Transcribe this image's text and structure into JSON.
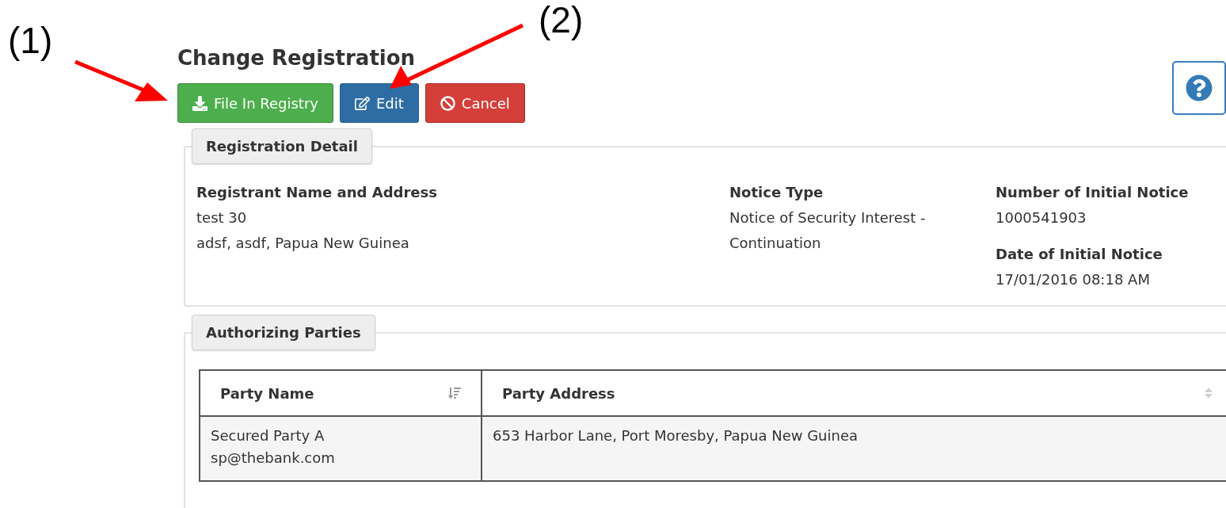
{
  "annotations": [
    {
      "label": "(1)"
    },
    {
      "label": "(2)"
    }
  ],
  "title": "Change Registration",
  "buttons": [
    {
      "kind": "file",
      "label": "File In Registry"
    },
    {
      "kind": "edit",
      "label": "Edit"
    },
    {
      "kind": "cancel",
      "label": "Cancel"
    }
  ],
  "registration_detail": {
    "legend": "Registration Detail",
    "fields": [
      {
        "label": "Registrant Name and Address",
        "lines": [
          "test 30",
          "adsf, asdf, Papua New Guinea"
        ]
      },
      {
        "label": "Notice Type",
        "lines": [
          "Notice of Security Interest -",
          "Continuation"
        ]
      },
      {
        "label": "Number of Initial Notice",
        "lines": [
          "1000541903"
        ]
      },
      {
        "label": "Date of Initial Notice",
        "lines": [
          "17/01/2016 08:18 AM"
        ]
      }
    ]
  },
  "authorizing_parties": {
    "legend": "Authorizing Parties",
    "columns": [
      {
        "label": "Party Name",
        "sorted": true
      },
      {
        "label": "Party Address",
        "sorted": false
      }
    ],
    "rows": [
      {
        "cells": [
          [
            "Secured Party A",
            "sp@thebank.com"
          ],
          [
            "653 Harbor Lane, Port Moresby, Papua New Guinea"
          ]
        ]
      }
    ]
  }
}
